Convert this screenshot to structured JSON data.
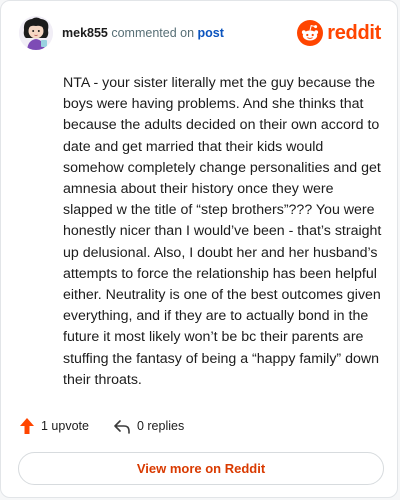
{
  "header": {
    "username": "mek855",
    "action_text": "commented on",
    "post_link": "post",
    "brand": "reddit"
  },
  "comment": {
    "text": "NTA - your sister literally met the guy because the boys were having problems. And she thinks that because the adults decided on their own accord to date and get married that their kids would somehow completely change personalities and get amnesia about their history once they were slapped w the title of “step brothers”??? You were honestly nicer than I would’ve been - that’s straight up delusional. Also, I doubt her and her husband’s attempts to force the relationship has been helpful either. Neutrality is one of the best outcomes given everything, and if they are to actually bond in the future it most likely won’t be bc their parents are stuffing the fantasy of being a “happy family” down their throats."
  },
  "actions": {
    "upvotes": "1 upvote",
    "replies": "0 replies"
  },
  "footer": {
    "view_more": "View more on Reddit"
  },
  "colors": {
    "brand": "#ff4500",
    "link": "#0a53be",
    "upvote_arrow": "#ff4500",
    "view_more_text": "#d93a00"
  },
  "icons": {
    "avatar": "user-avatar",
    "logo": "reddit-snoo-icon",
    "upvote": "upvote-arrow-icon",
    "reply": "reply-arrow-icon"
  }
}
